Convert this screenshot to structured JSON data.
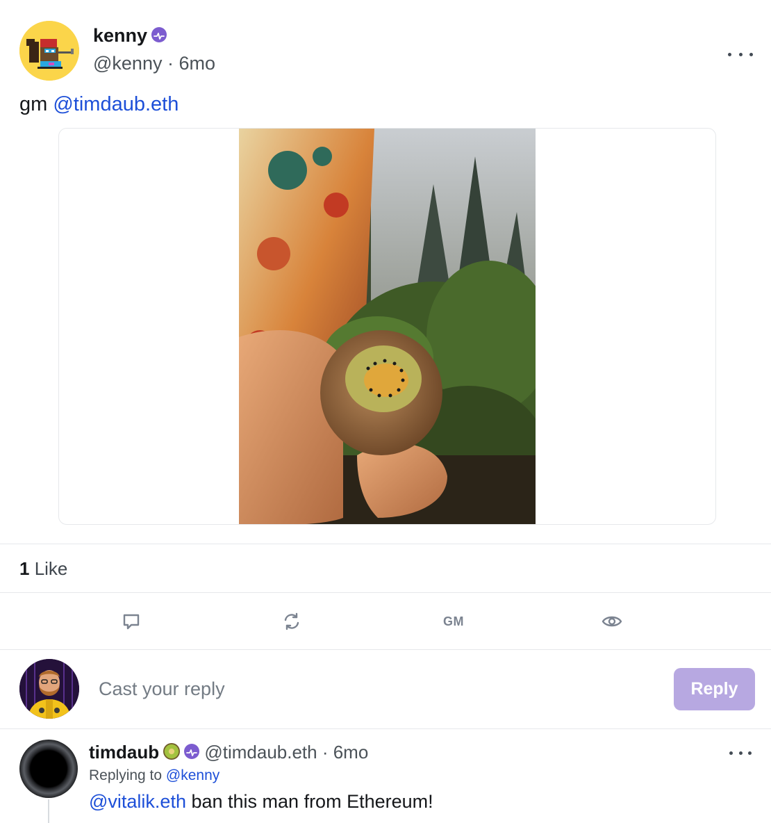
{
  "post": {
    "author_name": "kenny",
    "author_handle": "@kenny",
    "separator": " · ",
    "age": "6mo",
    "text_prefix": "gm ",
    "text_mention": "@timdaub.eth",
    "media_icon": "kiwi-photo"
  },
  "likes": {
    "count": "1",
    "label": " Like"
  },
  "actions": {
    "reply_icon": "comment-icon",
    "recast_icon": "recast-icon",
    "gm_label": "GM",
    "watch_icon": "eye-icon"
  },
  "composer": {
    "placeholder": "Cast your reply",
    "button_label": "Reply"
  },
  "reply": {
    "author_name": "timdaub",
    "author_handle": "@timdaub.eth",
    "separator": " · ",
    "age": "6mo",
    "replying_prefix": "Replying to ",
    "replying_to": "@kenny",
    "text_mention": "@vitalik.eth",
    "text_rest": " ban this man from Ethereum!"
  },
  "colors": {
    "mention": "#1d4fd8",
    "badge": "#7c5ccf",
    "reply_button": "#b7a8e1"
  }
}
